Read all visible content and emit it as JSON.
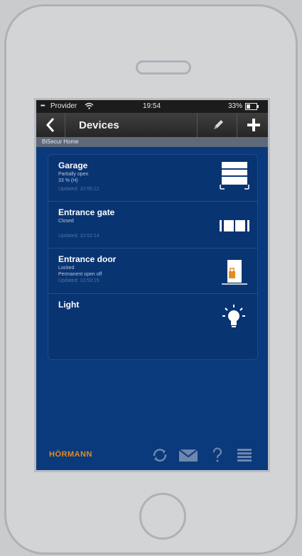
{
  "statusbar": {
    "carrier": "Provider",
    "time": "19:54",
    "battery": "33%"
  },
  "navbar": {
    "title": "Devices"
  },
  "section": {
    "label": "BiSecur Home"
  },
  "devices": [
    {
      "name": "Garage",
      "line1": "Partially open",
      "line2": "33 % (H)",
      "updated": "Updated: 10:55:12"
    },
    {
      "name": "Entrance gate",
      "line1": "Closed",
      "updated": "Updated: 10:52:14"
    },
    {
      "name": "Entrance door",
      "line1": "Locked",
      "line2": "Permanent open off",
      "updated": "Updated: 10:53:15"
    },
    {
      "name": "Light"
    }
  ],
  "brand": {
    "name": "HÖRMANN",
    "color": "#e58b1f"
  },
  "icons": {
    "back": "chevron-left-icon",
    "edit": "pencil-icon",
    "add": "plus-icon",
    "refresh": "refresh-icon",
    "messages": "envelope-icon",
    "help": "question-mark-icon",
    "menu": "hamburger-menu-icon",
    "garage": "garage-door-icon",
    "gate": "sliding-gate-icon",
    "door": "entrance-door-icon",
    "light": "light-bulb-icon"
  }
}
